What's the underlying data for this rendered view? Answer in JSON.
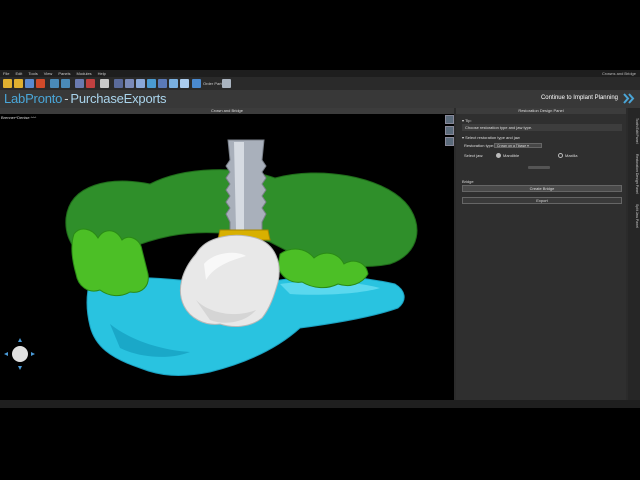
{
  "app": {
    "title": "Crowns and Bridge"
  },
  "menu": [
    "File",
    "Edit",
    "Tools",
    "View",
    "Panels",
    "Modules",
    "Help"
  ],
  "toolbar": {
    "order_parts_label": "Order Parts"
  },
  "brand": {
    "part1": "LabPronto",
    "separator": "-",
    "part2": "PurchaseExports"
  },
  "nav": {
    "continue_label": "Continue to Implant Planning"
  },
  "viewport": {
    "title": "Crown and Bridge",
    "patient_tag": "Brenner^Denise ^^^"
  },
  "panel": {
    "title": "Restoration Design Panel",
    "tips_label": "Tip:",
    "tips_text": "Choose restoration type and jaw type.",
    "select_section_label": "Select restoration type and jaw",
    "restoration_type_label": "Restoration type:",
    "restoration_type_value": "Crown on a Tibase",
    "jaw_label": "Select jaw:",
    "jaw_options": [
      "Mandible",
      "Maxilla"
    ],
    "bridge_section_label": "Bridge",
    "create_bridge_label": "Create Bridge",
    "export_label": "Export"
  },
  "side_tabs": [
    "Tooth Edit Panel",
    "Restoration Design Panel",
    "Split Jaw Panel"
  ],
  "colors": {
    "brand_primary": "#4aa6d8",
    "brand_secondary": "#aad4ec",
    "gingiva_green": "#2f8f2a",
    "lower_jaw_cyan": "#29c3e0",
    "crown_white": "#e8e8e8",
    "implant_gray": "#a9b0bb",
    "abutment_gold": "#d8b000"
  },
  "icons": [
    "folder-open-icon",
    "save-icon",
    "close-icon",
    "undo-icon",
    "redo-icon",
    "zoom-icon",
    "measure-icon",
    "move-icon",
    "rotate-icon",
    "cloud-icon",
    "cart-icon",
    "tools-icon"
  ]
}
